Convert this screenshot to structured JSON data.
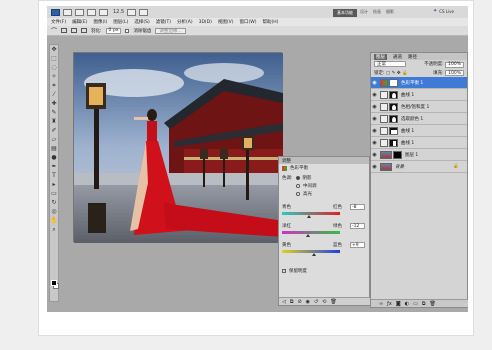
{
  "topbar": {
    "zoom_label": "12.5",
    "workspace_active": "基本功能",
    "workspace_others": [
      "设计",
      "绘画",
      "摄影"
    ],
    "cslive": "CS Live"
  },
  "menubar": {
    "items": [
      "文件(F)",
      "编辑(E)",
      "图像(I)",
      "图层(L)",
      "选择(S)",
      "滤镜(T)",
      "分析(A)",
      "3D(D)",
      "视图(V)",
      "窗口(W)",
      "帮助(H)"
    ]
  },
  "options": {
    "feather_label": "羽化:",
    "feather_value": "0 px",
    "antialias_label": "消除锯齿",
    "refine_edge": "调整边缘..."
  },
  "tools": [
    "move-icon",
    "marquee-icon",
    "lasso-icon",
    "magic-wand-icon",
    "crop-icon",
    "eyedropper-icon",
    "healing-icon",
    "brush-icon",
    "stamp-icon",
    "history-brush-icon",
    "eraser-icon",
    "gradient-icon",
    "dodge-icon",
    "pen-icon",
    "type-icon",
    "path-select-icon",
    "shape-icon",
    "3d-rotate-icon",
    "3d-orbit-icon",
    "hand-icon",
    "zoom-icon"
  ],
  "adjustments": {
    "tab_label": "调整",
    "panel_title": "色彩平衡",
    "tone_label": "色调:",
    "tones": [
      "阴影",
      "中间调",
      "高光"
    ],
    "selected_tone": "阴影",
    "sliders": [
      {
        "left": "青色",
        "right": "红色",
        "value": "-8",
        "knob_fraction": 0.46
      },
      {
        "left": "洋红",
        "right": "绿色",
        "value": "-12",
        "knob_fraction": 0.44
      },
      {
        "left": "黄色",
        "right": "蓝色",
        "value": "+9",
        "knob_fraction": 0.55
      }
    ],
    "preserve_label": "保留明度"
  },
  "layers_panel": {
    "tabs": [
      "图层",
      "通道",
      "路径"
    ],
    "blend_mode": "正常",
    "opacity_label": "不透明度:",
    "opacity_value": "100%",
    "lock_label": "锁定:",
    "fill_label": "填充:",
    "fill_value": "100%",
    "layers": [
      {
        "name": "色彩平衡 1",
        "selected": true
      },
      {
        "name": "曲线 1",
        "selected": false
      },
      {
        "name": "色相/饱和度 1",
        "selected": false
      },
      {
        "name": "选取颜色 1",
        "selected": false
      },
      {
        "name": "曲线 1",
        "selected": false
      },
      {
        "name": "曲线 1",
        "selected": false
      },
      {
        "name": "图层 1",
        "selected": false
      },
      {
        "name": "背景",
        "selected": false
      }
    ]
  },
  "colors": {
    "selected_layer": "#3e7ad6",
    "workspace_bg": "#a9a9a9",
    "dress_red": "#d0101a"
  }
}
